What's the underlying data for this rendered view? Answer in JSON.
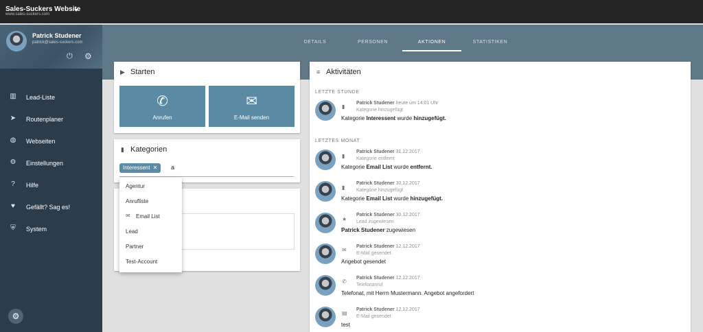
{
  "app": {
    "title": "Sales-Suckers Website",
    "url": "www.sales-suckers.com"
  },
  "user": {
    "name": "Patrick Studener",
    "email": "patrick@sales-suckers.com"
  },
  "sidebar": {
    "items": [
      {
        "label": "Lead-Liste",
        "icon": "building-icon"
      },
      {
        "label": "Routenplaner",
        "icon": "navigation-icon"
      },
      {
        "label": "Webseiten",
        "icon": "globe-icon"
      },
      {
        "label": "Einstellungen",
        "icon": "gear-icon"
      },
      {
        "label": "Hilfe",
        "icon": "help-icon"
      },
      {
        "label": "Gefällt? Sag es!",
        "icon": "heart-icon"
      },
      {
        "label": "System",
        "icon": "shield-icon"
      }
    ]
  },
  "tabs": [
    {
      "label": "DETAILS",
      "active": false
    },
    {
      "label": "PERSONEN",
      "active": false
    },
    {
      "label": "AKTIONEN",
      "active": true
    },
    {
      "label": "STATISTIKEN",
      "active": false
    }
  ],
  "starten": {
    "title": "Starten",
    "call_label": "Anrufen",
    "email_label": "E-Mail senden"
  },
  "kategorien": {
    "title": "Kategorien",
    "chip": "Interessent",
    "input_value": "a",
    "options": [
      {
        "label": "Agentur",
        "icon": ""
      },
      {
        "label": "Anrufliste",
        "icon": ""
      },
      {
        "label": "Email List",
        "icon": "mail-icon"
      },
      {
        "label": "Lead",
        "icon": ""
      },
      {
        "label": "Partner",
        "icon": ""
      },
      {
        "label": "Test-Account",
        "icon": ""
      }
    ]
  },
  "aktivitaeten": {
    "title": "Aktivitäten",
    "sections": {
      "recent": "LETZTE STUNDE",
      "month": "LETZTES MONAT"
    },
    "entries": [
      {
        "user": "Patrick Studener",
        "date": "heute um 14:01 Uhr",
        "type": "Kategorie hinzugefügt",
        "icon": "bookmark-icon",
        "text_a": "Kategorie ",
        "text_b": "Interessent",
        "text_c": " wurde ",
        "text_d": "hinzugefügt."
      },
      {
        "user": "Patrick Studener",
        "date": "31.12.2017",
        "type": "Kategorie entfernt",
        "icon": "bookmark-icon",
        "text_a": "Kategorie ",
        "text_b": "Email List",
        "text_c": " wurde ",
        "text_d": "entfernt."
      },
      {
        "user": "Patrick Studener",
        "date": "30.12.2017",
        "type": "Kategorie hinzugefügt",
        "icon": "bookmark-icon",
        "text_a": "Kategorie ",
        "text_b": "Email List",
        "text_c": " wurde ",
        "text_d": "hinzugefügt."
      },
      {
        "user": "Patrick Studener",
        "date": "30.12.2017",
        "type": "Lead zugewiesen",
        "icon": "star-icon",
        "text_a": "",
        "text_b": "Patrick Studener",
        "text_c": " zugewiesen",
        "text_d": ""
      },
      {
        "user": "Patrick Studener",
        "date": "12.12.2017",
        "type": "E-Mail gesendet",
        "icon": "mail-icon",
        "text_a": "Angebot gesendet",
        "text_b": "",
        "text_c": "",
        "text_d": ""
      },
      {
        "user": "Patrick Studener",
        "date": "12.12.2017",
        "type": "Telefonanruf",
        "icon": "phone-icon",
        "text_a": "Telefonat, mit Herrn Mustermann. Angebot angefordert",
        "text_b": "",
        "text_c": "",
        "text_d": ""
      },
      {
        "user": "Patrick Studener",
        "date": "12.12.2017",
        "type": "E-Mail gesendet",
        "icon": "message-icon",
        "text_a": "test",
        "text_b": "",
        "text_c": "",
        "text_d": ""
      }
    ]
  }
}
